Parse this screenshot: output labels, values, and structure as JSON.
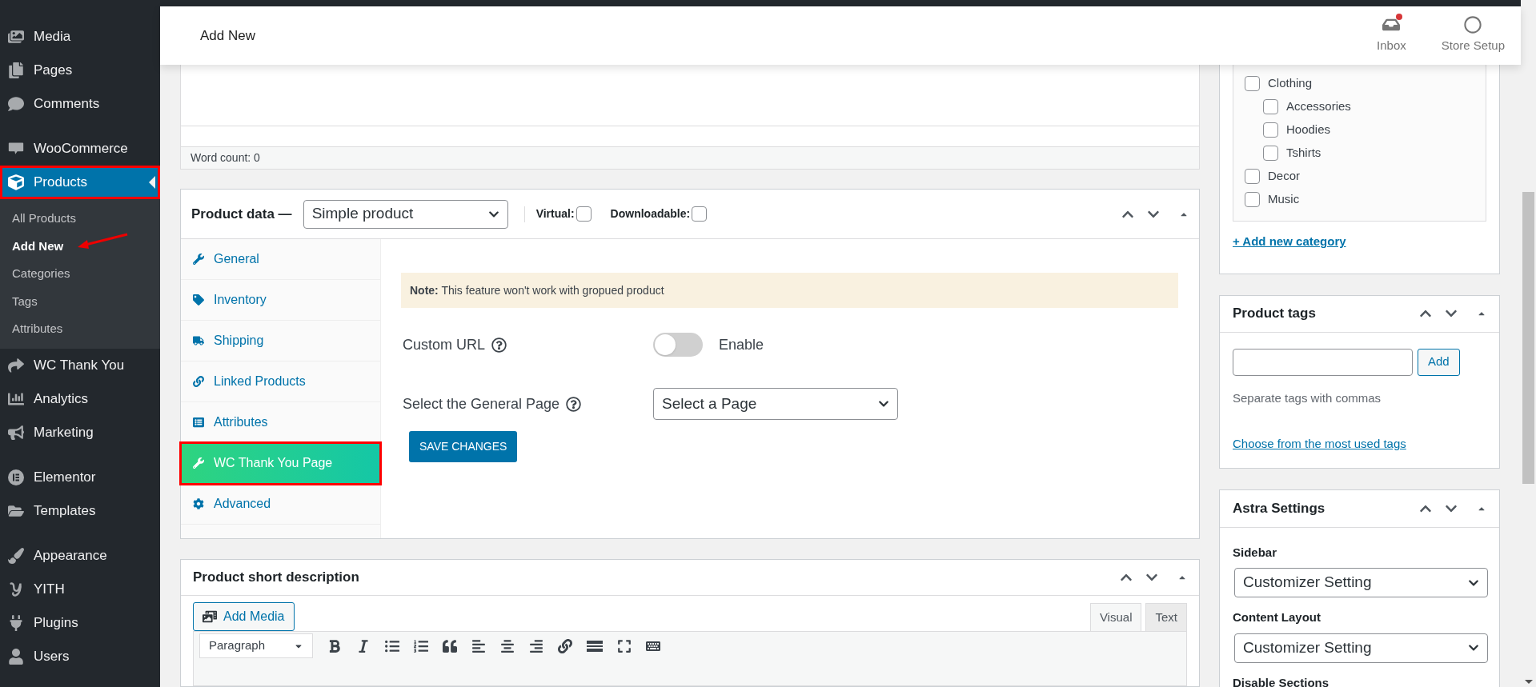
{
  "admin_menu": {
    "groups": [
      {
        "items": [
          {
            "label": "Media",
            "selected": false,
            "annotated": false
          },
          {
            "label": "Pages",
            "selected": false,
            "annotated": false
          },
          {
            "label": "Comments",
            "selected": false,
            "annotated": false
          }
        ]
      },
      {
        "items": [
          {
            "label": "WooCommerce",
            "selected": false,
            "annotated": false
          },
          {
            "label": "Products",
            "selected": true,
            "annotated": true,
            "submenu": [
              {
                "label": "All Products",
                "selected": false,
                "annotated": false
              },
              {
                "label": "Add New",
                "selected": true,
                "annotated": true
              },
              {
                "label": "Categories",
                "selected": false,
                "annotated": false
              },
              {
                "label": "Tags",
                "selected": false,
                "annotated": false
              },
              {
                "label": "Attributes",
                "selected": false,
                "annotated": false
              }
            ]
          },
          {
            "label": "WC Thank You",
            "selected": false,
            "annotated": false
          },
          {
            "label": "Analytics",
            "selected": false,
            "annotated": false
          },
          {
            "label": "Marketing",
            "selected": false,
            "annotated": false
          }
        ]
      },
      {
        "items": [
          {
            "label": "Elementor",
            "selected": false,
            "annotated": false
          },
          {
            "label": "Templates",
            "selected": false,
            "annotated": false
          }
        ]
      },
      {
        "items": [
          {
            "label": "Appearance",
            "selected": false,
            "annotated": false
          },
          {
            "label": "YITH",
            "selected": false,
            "annotated": false
          },
          {
            "label": "Plugins",
            "selected": false,
            "annotated": false
          },
          {
            "label": "Users",
            "selected": false,
            "annotated": false
          }
        ]
      }
    ]
  },
  "header": {
    "title": "Add New",
    "actions": [
      {
        "label": "Inbox",
        "unread": true
      },
      {
        "label": "Store Setup",
        "unread": false
      }
    ]
  },
  "editor": {
    "word_count": "Word count: 0"
  },
  "product_data": {
    "title": "Product data —",
    "type_select": "Simple product",
    "options": [
      {
        "label": "Virtual:",
        "checked": false
      },
      {
        "label": "Downloadable:",
        "checked": false
      }
    ],
    "tabs": [
      {
        "label": "General",
        "selected": false,
        "annotated": false
      },
      {
        "label": "Inventory",
        "selected": false,
        "annotated": false
      },
      {
        "label": "Shipping",
        "selected": false,
        "annotated": false
      },
      {
        "label": "Linked Products",
        "selected": false,
        "annotated": false
      },
      {
        "label": "Attributes",
        "selected": false,
        "annotated": false
      },
      {
        "label": "WC Thank You Page",
        "selected": true,
        "annotated": true
      },
      {
        "label": "Advanced",
        "selected": false,
        "annotated": false
      }
    ],
    "panel": {
      "note": "**Note:** This feature won't work with gropued product",
      "custom_url": {
        "label": "Custom URL",
        "on": false,
        "toggle_label": "Enable"
      },
      "page_select": {
        "label": "Select the General Page",
        "value": "Select a Page"
      },
      "save_button": "SAVE CHANGES"
    }
  },
  "short_description": {
    "title": "Product short description",
    "add_media": "Add Media",
    "editor_tabs": [
      {
        "label": "Visual",
        "selected": true
      },
      {
        "label": "Text",
        "selected": false
      }
    ],
    "format_select": "Paragraph"
  },
  "categories": {
    "items": [
      {
        "label": "Clothing",
        "checked": false,
        "children": [
          {
            "label": "Accessories",
            "checked": false
          },
          {
            "label": "Hoodies",
            "checked": false
          },
          {
            "label": "Tshirts",
            "checked": false
          }
        ]
      },
      {
        "label": "Decor",
        "checked": false
      },
      {
        "label": "Music",
        "checked": false
      }
    ],
    "add_link": "+ Add new category"
  },
  "product_tags": {
    "title": "Product tags",
    "add_button": "Add",
    "hint": "Separate tags with commas",
    "link": "Choose from the most used tags"
  },
  "astra_settings": {
    "title": "Astra Settings",
    "fields": [
      {
        "label": "Sidebar",
        "value": "Customizer Setting"
      },
      {
        "label": "Content Layout",
        "value": "Customizer Setting"
      }
    ],
    "section_label": "Disable Sections"
  }
}
